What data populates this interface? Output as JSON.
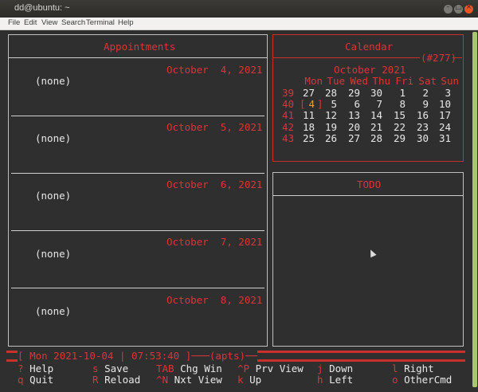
{
  "window": {
    "title": "dd@ubuntu: ~",
    "accent": "#e95420"
  },
  "menu": [
    "File",
    "Edit",
    "View",
    "Search",
    "Terminal",
    "Help"
  ],
  "appointments": {
    "title": "Appointments",
    "days": [
      {
        "date": "October  4, 2021",
        "entry": "(none)"
      },
      {
        "date": "October  5, 2021",
        "entry": "(none)"
      },
      {
        "date": "October  6, 2021",
        "entry": "(none)"
      },
      {
        "date": "October  7, 2021",
        "entry": "(none)"
      },
      {
        "date": "October  8, 2021",
        "entry": "(none)"
      }
    ]
  },
  "calendar": {
    "title": "Calendar",
    "day_of_year": "(#277)",
    "month": "October 2021",
    "weekdays": [
      "Mon",
      "Tue",
      "Wed",
      "Thu",
      "Fri",
      "Sat",
      "Sun"
    ],
    "weeks": [
      {
        "num": "39",
        "days": [
          "27",
          "28",
          "29",
          "30",
          "1",
          "2",
          "3"
        ]
      },
      {
        "num": "40",
        "days": [
          "4",
          "5",
          "6",
          "7",
          "8",
          "9",
          "10"
        ]
      },
      {
        "num": "41",
        "days": [
          "11",
          "12",
          "13",
          "14",
          "15",
          "16",
          "17"
        ]
      },
      {
        "num": "42",
        "days": [
          "18",
          "19",
          "20",
          "21",
          "22",
          "23",
          "24"
        ]
      },
      {
        "num": "43",
        "days": [
          "25",
          "26",
          "27",
          "28",
          "29",
          "30",
          "31"
        ]
      }
    ],
    "selected": "4"
  },
  "todo": {
    "title": "TODO"
  },
  "status": {
    "date": "Mon 2021-10-04",
    "time": "07:53:40",
    "mode": "(apts)"
  },
  "keys": [
    [
      {
        "k": "?",
        "l": "Help"
      },
      {
        "k": "s",
        "l": "Save"
      },
      {
        "k": "TAB",
        "l": "Chg Win"
      },
      {
        "k": "^P",
        "l": "Prv View"
      },
      {
        "k": "j",
        "l": "Down"
      },
      {
        "k": "l",
        "l": "Right"
      }
    ],
    [
      {
        "k": "q",
        "l": "Quit"
      },
      {
        "k": "R",
        "l": "Reload"
      },
      {
        "k": "^N",
        "l": "Nxt View"
      },
      {
        "k": "k",
        "l": "Up"
      },
      {
        "k": "h",
        "l": "Left"
      },
      {
        "k": "o",
        "l": "OtherCmd"
      }
    ]
  ]
}
